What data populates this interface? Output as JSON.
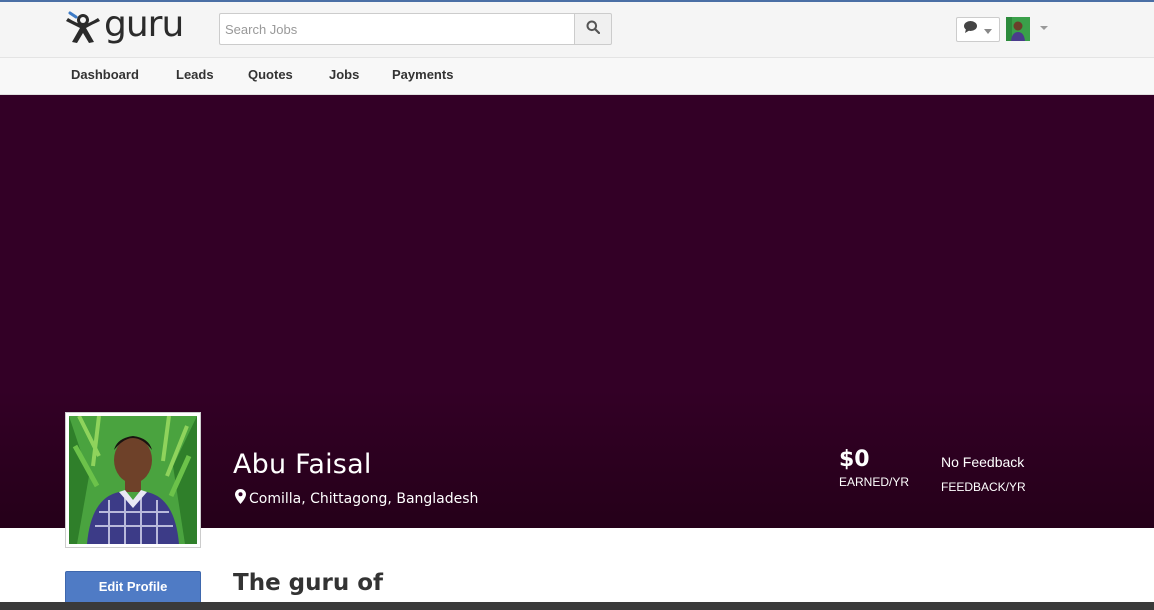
{
  "app": {
    "logo_text": "guru"
  },
  "search": {
    "placeholder": "Search Jobs"
  },
  "nav": {
    "items": [
      {
        "label": "Dashboard"
      },
      {
        "label": "Leads"
      },
      {
        "label": "Quotes"
      },
      {
        "label": "Jobs"
      },
      {
        "label": "Payments"
      }
    ]
  },
  "profile": {
    "name": "Abu Faisal",
    "location": "Comilla, Chittagong, Bangladesh",
    "earned_value": "$0",
    "earned_label": "EARNED/YR",
    "feedback_value": "No Feedback",
    "feedback_label": "FEEDBACK/YR",
    "edit_label": "Edit Profile",
    "headline": "The guru of"
  },
  "colors": {
    "hero_bg": "#330026",
    "accent_button": "#4f7bc5"
  },
  "icons": {
    "logo": "guru-logo-icon",
    "search": "search-icon",
    "messages": "chat-bubble-icon",
    "location": "map-marker-icon"
  }
}
